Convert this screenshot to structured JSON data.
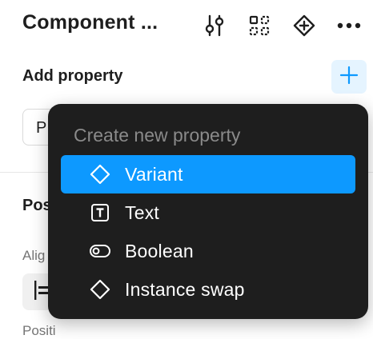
{
  "header": {
    "title": "Component ...",
    "icons": [
      "adjust-icon",
      "component-grid-icon",
      "component-diamond-icon",
      "more-icon"
    ]
  },
  "properties": {
    "section_title": "Add property",
    "add_icon": "plus-icon",
    "input_partial": "P"
  },
  "position": {
    "section_title": "Pos",
    "align_label": "Alig",
    "position_label": "Positi"
  },
  "dropdown": {
    "header": "Create new property",
    "items": [
      {
        "label": "Variant",
        "icon": "diamond-icon",
        "selected": true
      },
      {
        "label": "Text",
        "icon": "text-icon",
        "selected": false
      },
      {
        "label": "Boolean",
        "icon": "toggle-icon",
        "selected": false
      },
      {
        "label": "Instance swap",
        "icon": "diamond-icon",
        "selected": false
      }
    ]
  },
  "colors": {
    "accent": "#0d99ff",
    "menu_bg": "#1e1e1e",
    "plus_bg": "#e5f4ff"
  }
}
